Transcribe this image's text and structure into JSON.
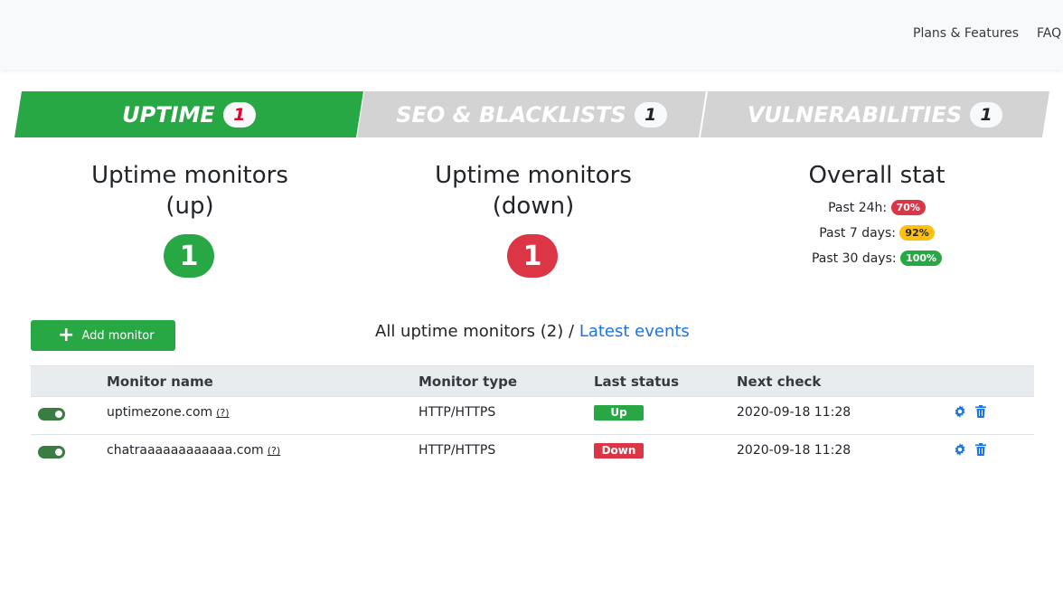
{
  "nav": {
    "plans": "Plans & Features",
    "faq": "FAQ"
  },
  "tabs": [
    {
      "label": "UPTIME",
      "count": "1"
    },
    {
      "label": "SEO & BLACKLISTS",
      "count": "1"
    },
    {
      "label": "VULNERABILITIES",
      "count": "1"
    }
  ],
  "stats": {
    "up_title_1": "Uptime monitors",
    "up_title_2": "(up)",
    "up_count": "1",
    "down_title_1": "Uptime monitors",
    "down_title_2": "(down)",
    "down_count": "1",
    "overall_title": "Overall stat",
    "past24_label": "Past 24h:",
    "past24_value": "70%",
    "past7_label": "Past 7 days:",
    "past7_value": "92%",
    "past30_label": "Past 30 days:",
    "past30_value": "100%"
  },
  "toolbar": {
    "add_label": "Add monitor",
    "add_icon": "plus-icon"
  },
  "list": {
    "title": "All uptime monitors (2)",
    "sep": " / ",
    "events_link": "Latest events"
  },
  "table": {
    "headers": {
      "name": "Monitor name",
      "type": "Monitor type",
      "status": "Last status",
      "next": "Next check"
    },
    "rows": [
      {
        "name": "uptimezone.com",
        "help": "(?)",
        "type": "HTTP/HTTPS",
        "status": "Up",
        "next": "2020-09-18 11:28"
      },
      {
        "name": "chatraaaaaaaaaaaa.com",
        "help": "(?)",
        "type": "HTTP/HTTPS",
        "status": "Down",
        "next": "2020-09-18 11:28"
      }
    ]
  },
  "colors": {
    "green": "#28a745",
    "red": "#dc3545",
    "yellow": "#ffc107",
    "link": "#1a73e8",
    "inactive_tab": "#d3d3d3"
  }
}
